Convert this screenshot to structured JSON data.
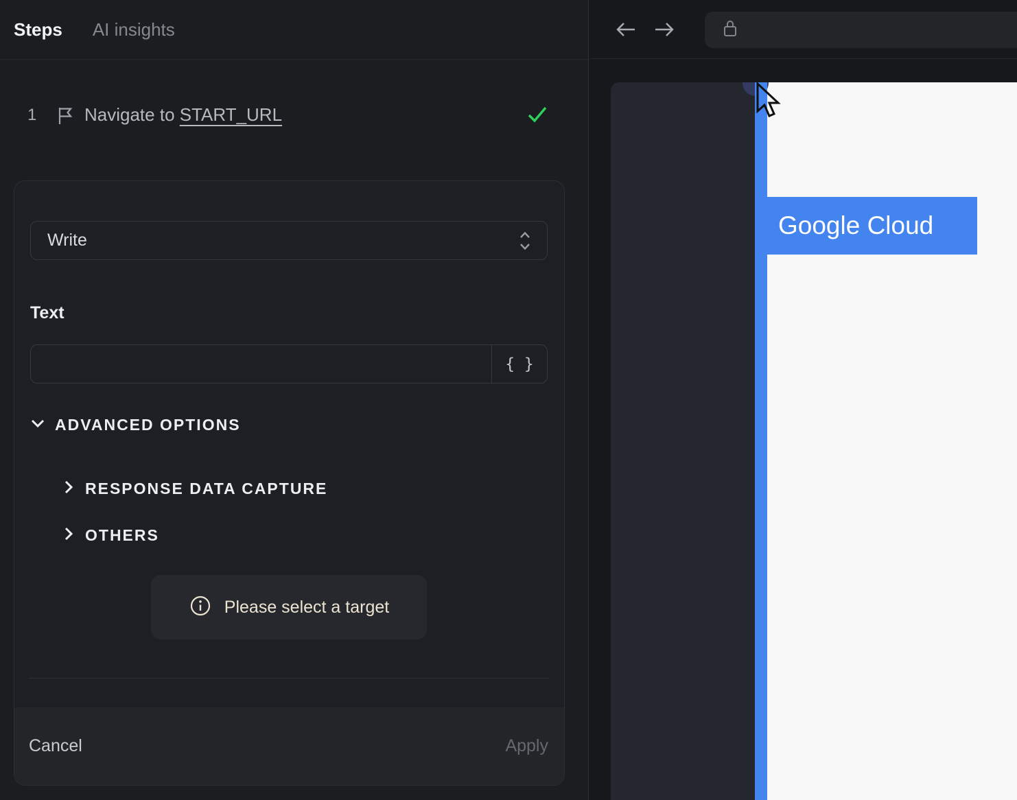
{
  "left_panel": {
    "tabs": [
      {
        "label": "Steps",
        "active": true
      },
      {
        "label": "AI insights",
        "active": false
      }
    ],
    "step": {
      "number": "1",
      "text_prefix": "Navigate to ",
      "link_text": "START_URL",
      "status": "success"
    },
    "editor": {
      "action_select": {
        "value": "Write"
      },
      "text_field": {
        "label": "Text",
        "value": "",
        "placeholder": "",
        "insert_token_label": "{ }"
      },
      "advanced_options": {
        "label": "ADVANCED OPTIONS",
        "expanded": true,
        "sections": [
          {
            "label": "RESPONSE DATA CAPTURE",
            "expanded": false
          },
          {
            "label": "OTHERS",
            "expanded": false
          }
        ]
      },
      "notice": {
        "text": "Please select a target"
      },
      "footer": {
        "cancel_label": "Cancel",
        "apply_label": "Apply",
        "apply_enabled": false
      }
    }
  },
  "browser": {
    "toolbar": {
      "url_value": ""
    },
    "page": {
      "highlight_label": "Google Cloud"
    }
  },
  "icons": {
    "step": "flag-icon",
    "step_status": "check-icon",
    "action_select": "chevron-up-down-icon",
    "insert_variable": "braces-token-icon",
    "advanced_toggle": "chevron-down-icon",
    "section_toggle": "chevron-right-icon",
    "notice": "info-icon",
    "back": "arrow-left-icon",
    "forward": "arrow-right-icon",
    "security": "lock-icon",
    "pointer": "cursor-arrow-icon"
  },
  "colors": {
    "accent_blue": "#4384ee",
    "success_green": "#2fd35a",
    "notice_text": "#ece4d0"
  }
}
